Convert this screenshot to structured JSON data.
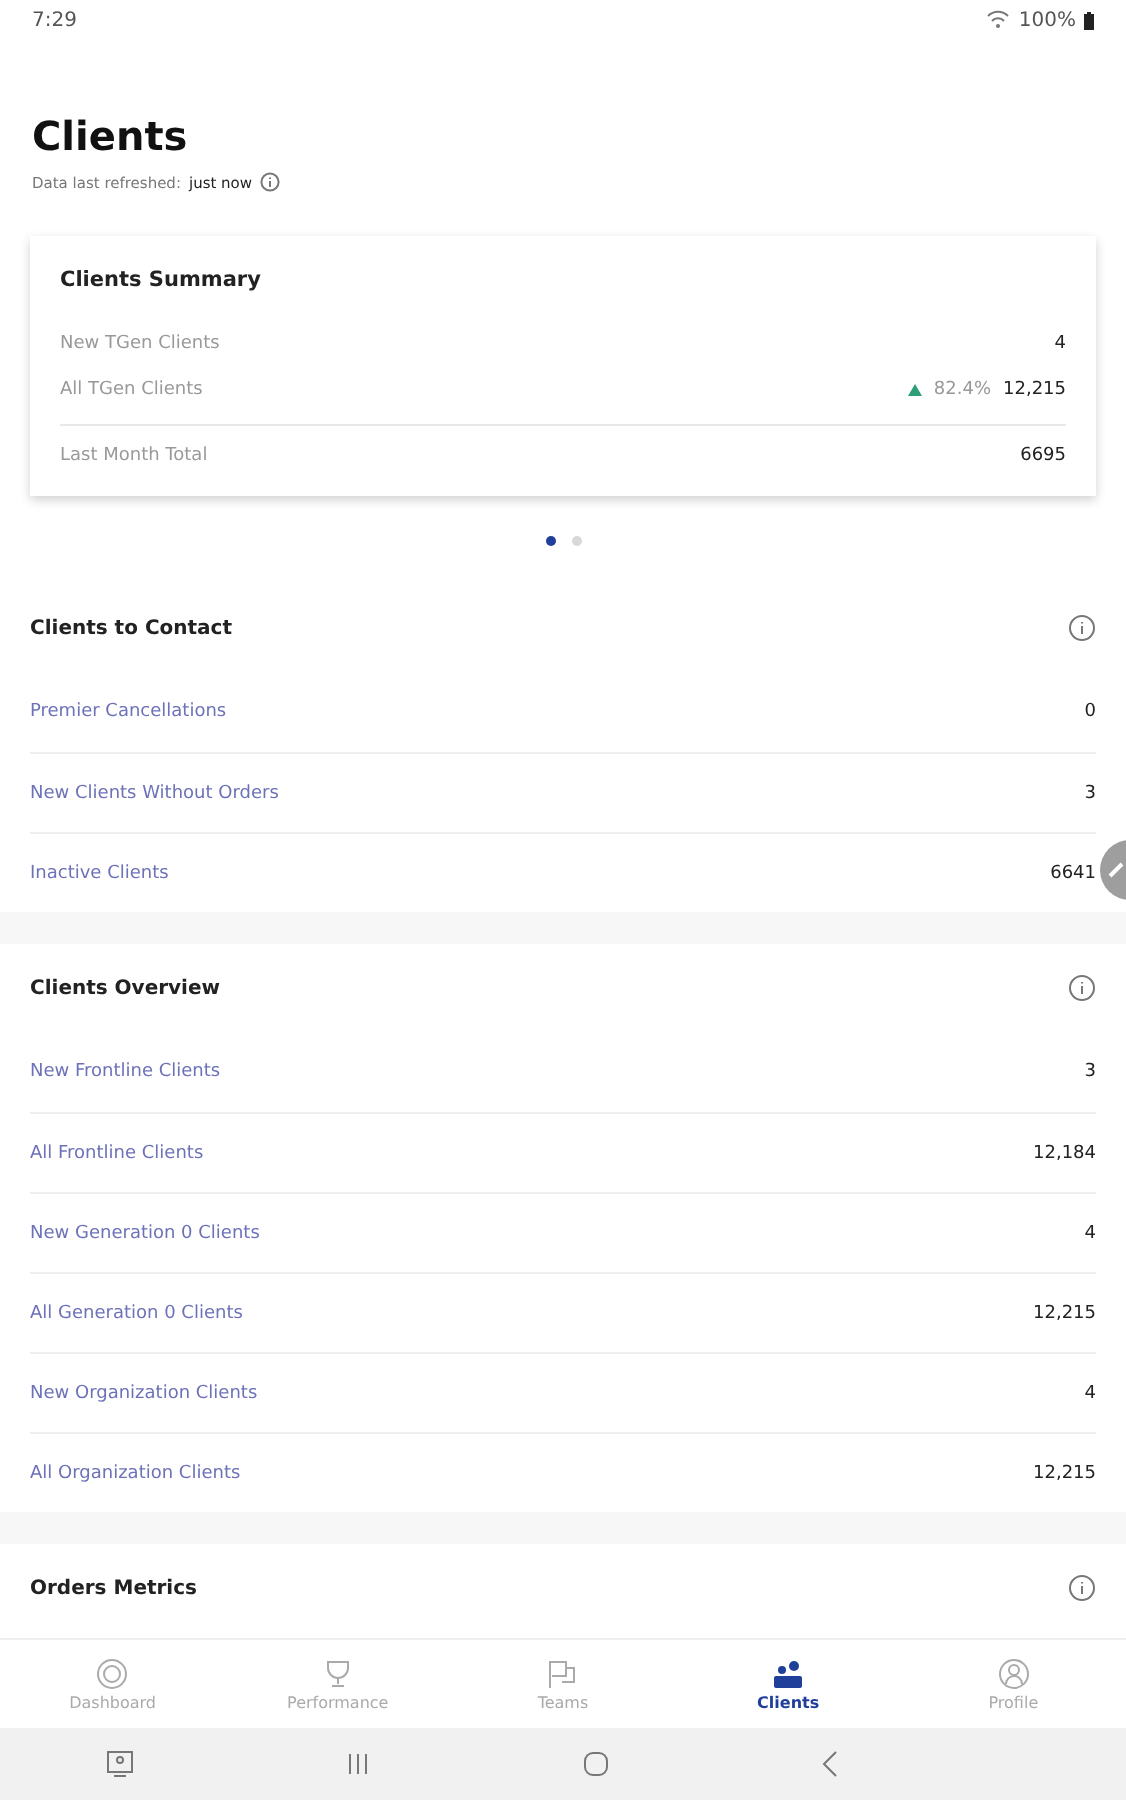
{
  "status_bar": {
    "time": "7:29",
    "battery": "100%"
  },
  "header": {
    "title": "Clients",
    "refreshed_label": "Data last refreshed:",
    "refreshed_value": "just now"
  },
  "summary_card": {
    "title": "Clients Summary",
    "rows": [
      {
        "label": "New TGen Clients",
        "value": "4"
      },
      {
        "label": "All TGen Clients",
        "change": "82.4%",
        "value": "12,215"
      }
    ],
    "total": {
      "label": "Last Month Total",
      "value": "6695"
    }
  },
  "page_indicator": [
    {
      "selected": true
    },
    {
      "selected": false
    }
  ],
  "sections": [
    {
      "title": "Clients to Contact",
      "rows": [
        {
          "label": "Premier Cancellations",
          "value": "0"
        },
        {
          "label": "New Clients Without Orders",
          "value": "3"
        },
        {
          "label": "Inactive Clients",
          "value": "6641"
        }
      ]
    },
    {
      "title": "Clients Overview",
      "rows": [
        {
          "label": "New Frontline Clients",
          "value": "3"
        },
        {
          "label": "All Frontline Clients",
          "value": "12,184"
        },
        {
          "label": "New Generation 0 Clients",
          "value": "4"
        },
        {
          "label": "All Generation 0 Clients",
          "value": "12,215"
        },
        {
          "label": "New Organization Clients",
          "value": "4"
        },
        {
          "label": "All Organization Clients",
          "value": "12,215"
        }
      ]
    },
    {
      "title": "Orders Metrics"
    }
  ],
  "bottom_nav": [
    {
      "label": "Dashboard",
      "selected": false
    },
    {
      "label": "Performance",
      "selected": false
    },
    {
      "label": "Teams",
      "selected": false
    },
    {
      "label": "Clients",
      "selected": true
    },
    {
      "label": "Profile",
      "selected": false
    }
  ]
}
